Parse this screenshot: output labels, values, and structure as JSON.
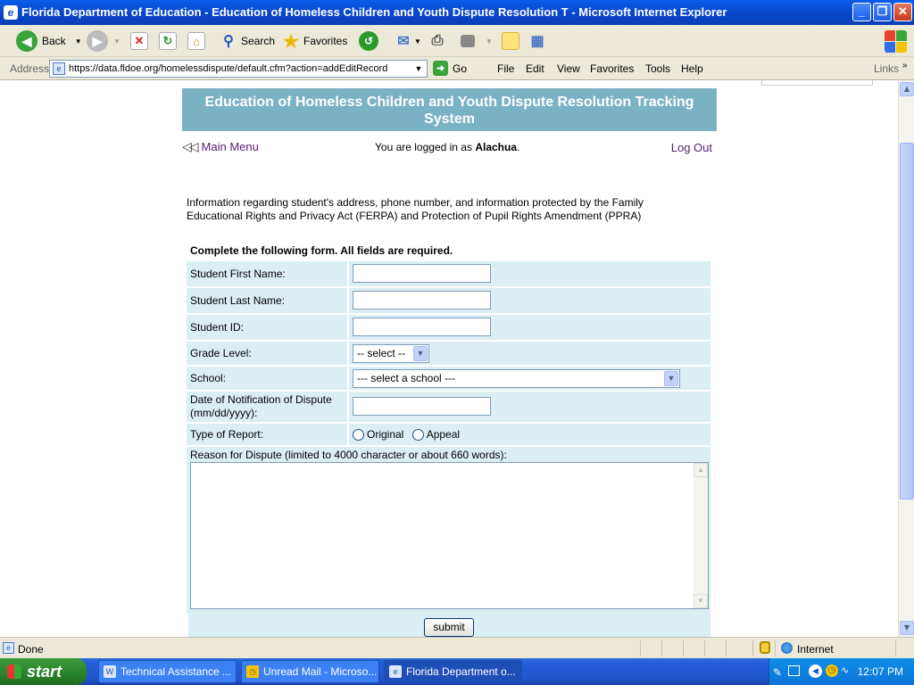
{
  "window": {
    "title": "Florida Department of Education - Education of Homeless Children and Youth Dispute Resolution T - Microsoft Internet Explorer",
    "min": "_",
    "max": "❐",
    "close": "✕"
  },
  "toolbar": {
    "back": "Back",
    "search": "Search",
    "favorites": "Favorites"
  },
  "address": {
    "label": "Address",
    "url": "https://data.fldoe.org/homelessdispute/default.cfm?action=addEditRecord",
    "go": "Go",
    "links": "Links"
  },
  "menu": [
    "File",
    "Edit",
    "View",
    "Favorites",
    "Tools",
    "Help"
  ],
  "page": {
    "banner": "Education of Homeless Children and Youth Dispute Resolution Tracking System",
    "main_menu": "Main Menu",
    "logged_in_prefix": "You are logged in as ",
    "logged_in_user": "Alachua",
    "logged_in_suffix": ".",
    "logout": "Log Out",
    "info": "Information regarding student's address, phone number, and information protected by the Family Educational Rights and Privacy Act (FERPA) and Protection of Pupil Rights Amendment (PPRA)",
    "form_heading": "Complete the following form. All fields are required.",
    "fields": {
      "first_name": "Student First Name:",
      "last_name": "Student Last Name:",
      "student_id": "Student ID:",
      "grade_level": "Grade Level:",
      "grade_select": "-- select --",
      "school": "School:",
      "school_select": "--- select a school ---",
      "date_notification": "Date of Notification of Dispute (mm/dd/yyyy):",
      "type_report": "Type of Report:",
      "type_original": "Original",
      "type_appeal": "Appeal",
      "reason": "Reason for Dispute (limited to 4000 character or about 660 words):"
    },
    "submit": "submit"
  },
  "status": {
    "text": "Done",
    "zone": "Internet"
  },
  "taskbar": {
    "start": "start",
    "tasks": [
      "Technical Assistance ...",
      "Unread Mail - Microso...",
      "Florida Department o..."
    ],
    "clock": "12:07 PM"
  }
}
